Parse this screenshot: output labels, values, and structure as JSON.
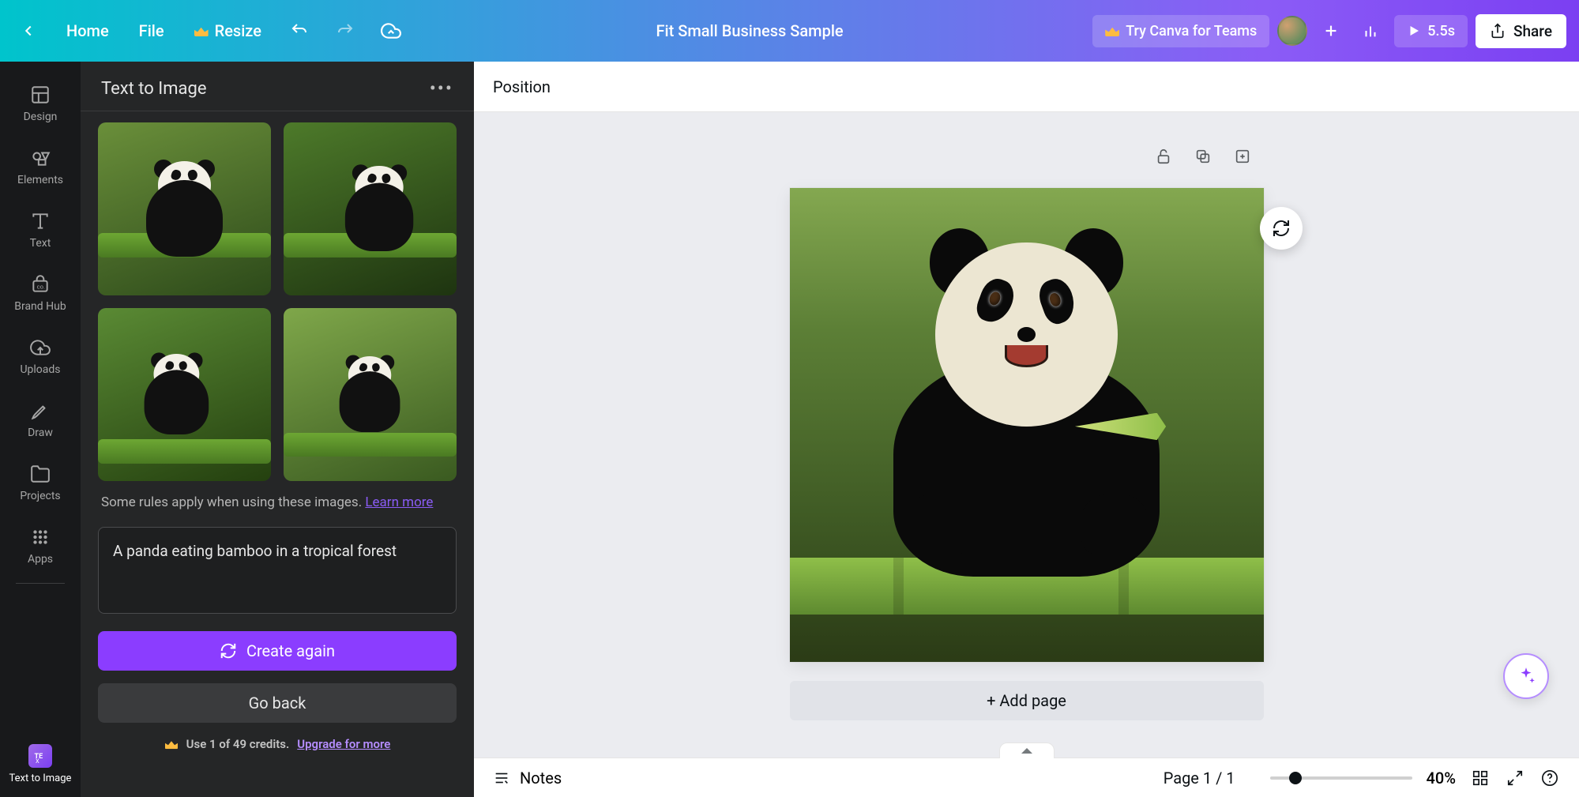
{
  "header": {
    "home": "Home",
    "file": "File",
    "resize": "Resize",
    "doc_title": "Fit Small Business Sample",
    "try_teams": "Try Canva for Teams",
    "presentation_time": "5.5s",
    "share": "Share"
  },
  "rail": {
    "items": [
      {
        "id": "design",
        "label": "Design"
      },
      {
        "id": "elements",
        "label": "Elements"
      },
      {
        "id": "text",
        "label": "Text"
      },
      {
        "id": "brandhub",
        "label": "Brand Hub"
      },
      {
        "id": "uploads",
        "label": "Uploads"
      },
      {
        "id": "draw",
        "label": "Draw"
      },
      {
        "id": "projects",
        "label": "Projects"
      },
      {
        "id": "apps",
        "label": "Apps"
      }
    ],
    "bottom": {
      "id": "tti",
      "label": "Text to Image"
    }
  },
  "panel": {
    "title": "Text to Image",
    "rules_text_prefix": "Some rules apply when using these images. ",
    "rules_link": "Learn more",
    "prompt_value": "A panda eating bamboo in a tropical forest",
    "create_again": "Create again",
    "go_back": "Go back",
    "credits_text": "Use 1 of 49 credits.",
    "upgrade_link": "Upgrade for more"
  },
  "editor": {
    "position": "Position",
    "add_page": "+ Add page",
    "notes": "Notes",
    "page_counter": "Page 1 / 1",
    "zoom_pct": "40%"
  }
}
